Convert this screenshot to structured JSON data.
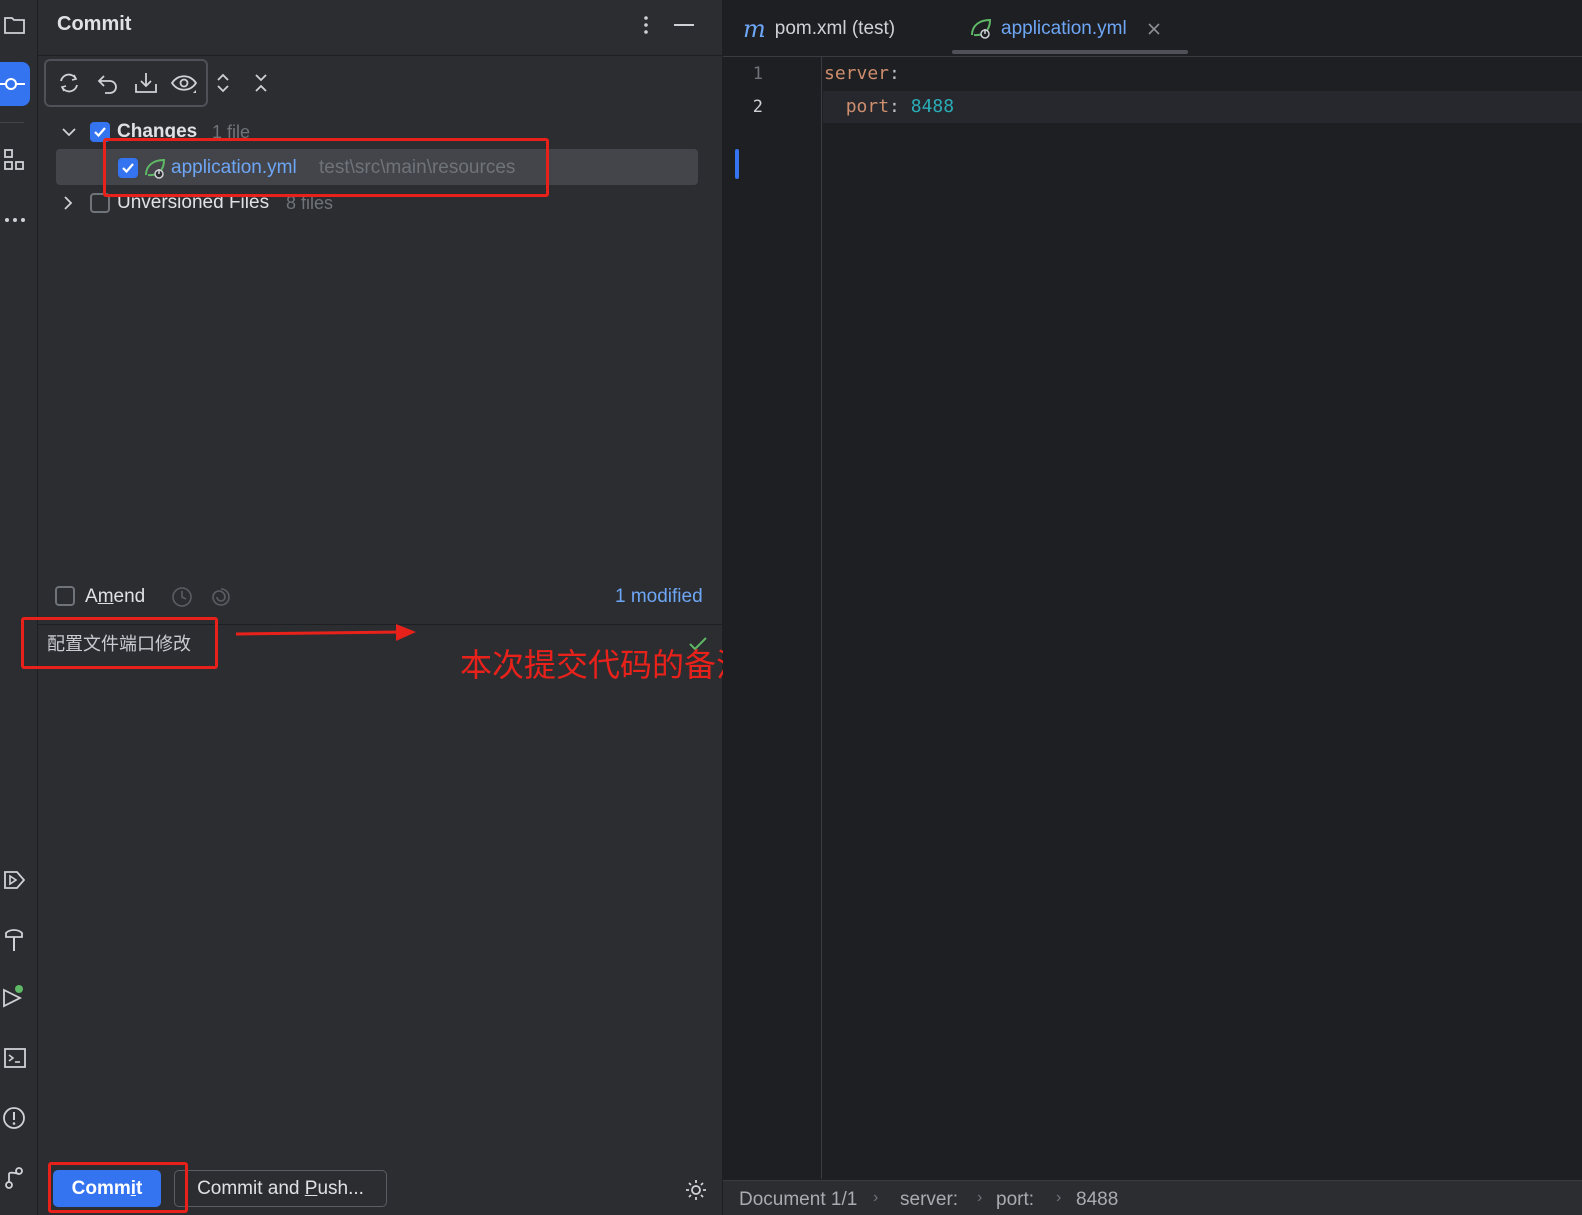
{
  "commit_panel": {
    "title": "Commit",
    "changes": {
      "label": "Changes",
      "count": "1 file"
    },
    "file": {
      "name": "application.yml",
      "path": "test\\src\\main\\resources"
    },
    "unversioned": {
      "label": "Unversioned Files",
      "count": "8 files"
    },
    "amend_label_pre": "A",
    "amend_label_u": "m",
    "amend_label_post": "end",
    "modified_count": "1 modified",
    "commit_message": "配置文件端口修改",
    "commit_button": {
      "pre": "Comm",
      "u": "i",
      "post": "t"
    },
    "commit_push_button": {
      "pre": "Commit and ",
      "u": "P",
      "post": "ush..."
    }
  },
  "annotation": {
    "text": "本次提交代码的备注"
  },
  "editor": {
    "tabs": [
      {
        "label": "pom.xml (test)",
        "icon": "maven-icon",
        "active": false
      },
      {
        "label": "application.yml",
        "icon": "spring-leaf-icon",
        "active": true
      }
    ],
    "lines": [
      {
        "number": "1",
        "key": "server",
        "colon": ":"
      },
      {
        "number": "2",
        "key": "port",
        "colon": ":",
        "value": "8488"
      }
    ]
  },
  "statusbar": {
    "breadcrumbs": [
      "Document 1/1",
      "server:",
      "port:",
      "8488"
    ]
  },
  "colors": {
    "accent": "#3574f0",
    "annotation_red": "#e8221b",
    "yaml_key": "#cf8e6d",
    "yaml_number": "#2aacb8"
  }
}
